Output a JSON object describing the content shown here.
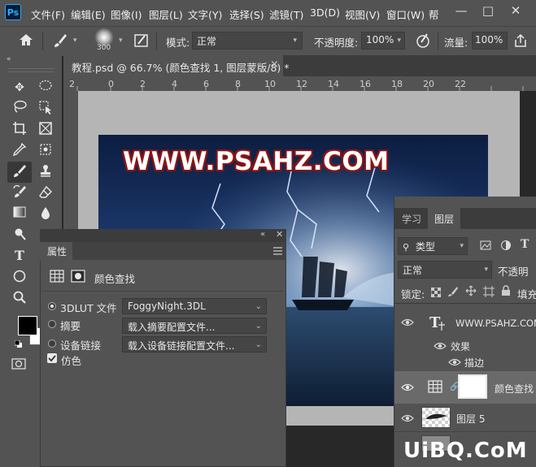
{
  "menubar": {
    "logo": "Ps",
    "items": [
      "文件(F)",
      "编辑(E)",
      "图像(I)",
      "图层(L)",
      "文字(Y)",
      "选择(S)",
      "滤镜(T)",
      "3D(D)",
      "视图(V)",
      "窗口(W)",
      "帮"
    ],
    "window_controls": [
      "—",
      "□",
      "✕"
    ]
  },
  "options": {
    "brush_size": "300",
    "mode_label": "模式:",
    "mode_value": "正常",
    "opacity_label": "不透明度:",
    "opacity_value": "100%",
    "flow_label": "流量:",
    "flow_value": "100%"
  },
  "document": {
    "tab_title": "教程.psd @ 66.7% (颜色查找 1, 图层蒙版/8) *",
    "close": "×",
    "headline": "WWW.PSAHZ.COM"
  },
  "ruler": {
    "ticks": [
      "2",
      "0",
      "2",
      "4",
      "6",
      "8",
      "10",
      "12",
      "14",
      "16",
      "18",
      "20",
      "22"
    ]
  },
  "properties": {
    "title": "属性",
    "adjustment_name": "颜色查找",
    "rows": [
      {
        "label": "3DLUT 文件",
        "value": "FoggyNight.3DL",
        "selected": true
      },
      {
        "label": "摘要",
        "value": "载入摘要配置文件...",
        "selected": false
      },
      {
        "label": "设备链接",
        "value": "载入设备链接配置文件...",
        "selected": false
      }
    ],
    "dither_label": "仿色",
    "dither_checked": true
  },
  "layers": {
    "tabs": [
      "学习",
      "图层"
    ],
    "filter_label": "类型",
    "blend_mode": "正常",
    "opacity_label": "不透明",
    "lock_label": "锁定:",
    "fill_label": "填充",
    "items": [
      {
        "name": "WWW.PSAHZ.COM",
        "type": "text"
      },
      {
        "name": "效果",
        "type": "effect-group"
      },
      {
        "name": "描边",
        "type": "effect"
      },
      {
        "name": "颜色查找",
        "type": "adjustment"
      },
      {
        "name": "图层 5",
        "type": "pixel"
      }
    ]
  },
  "watermark": "UiBQ.CoM",
  "colors": {
    "chrome": "#535353",
    "dark": "#282828",
    "accent": "#31a8ff",
    "stroke": "#8b1414"
  }
}
